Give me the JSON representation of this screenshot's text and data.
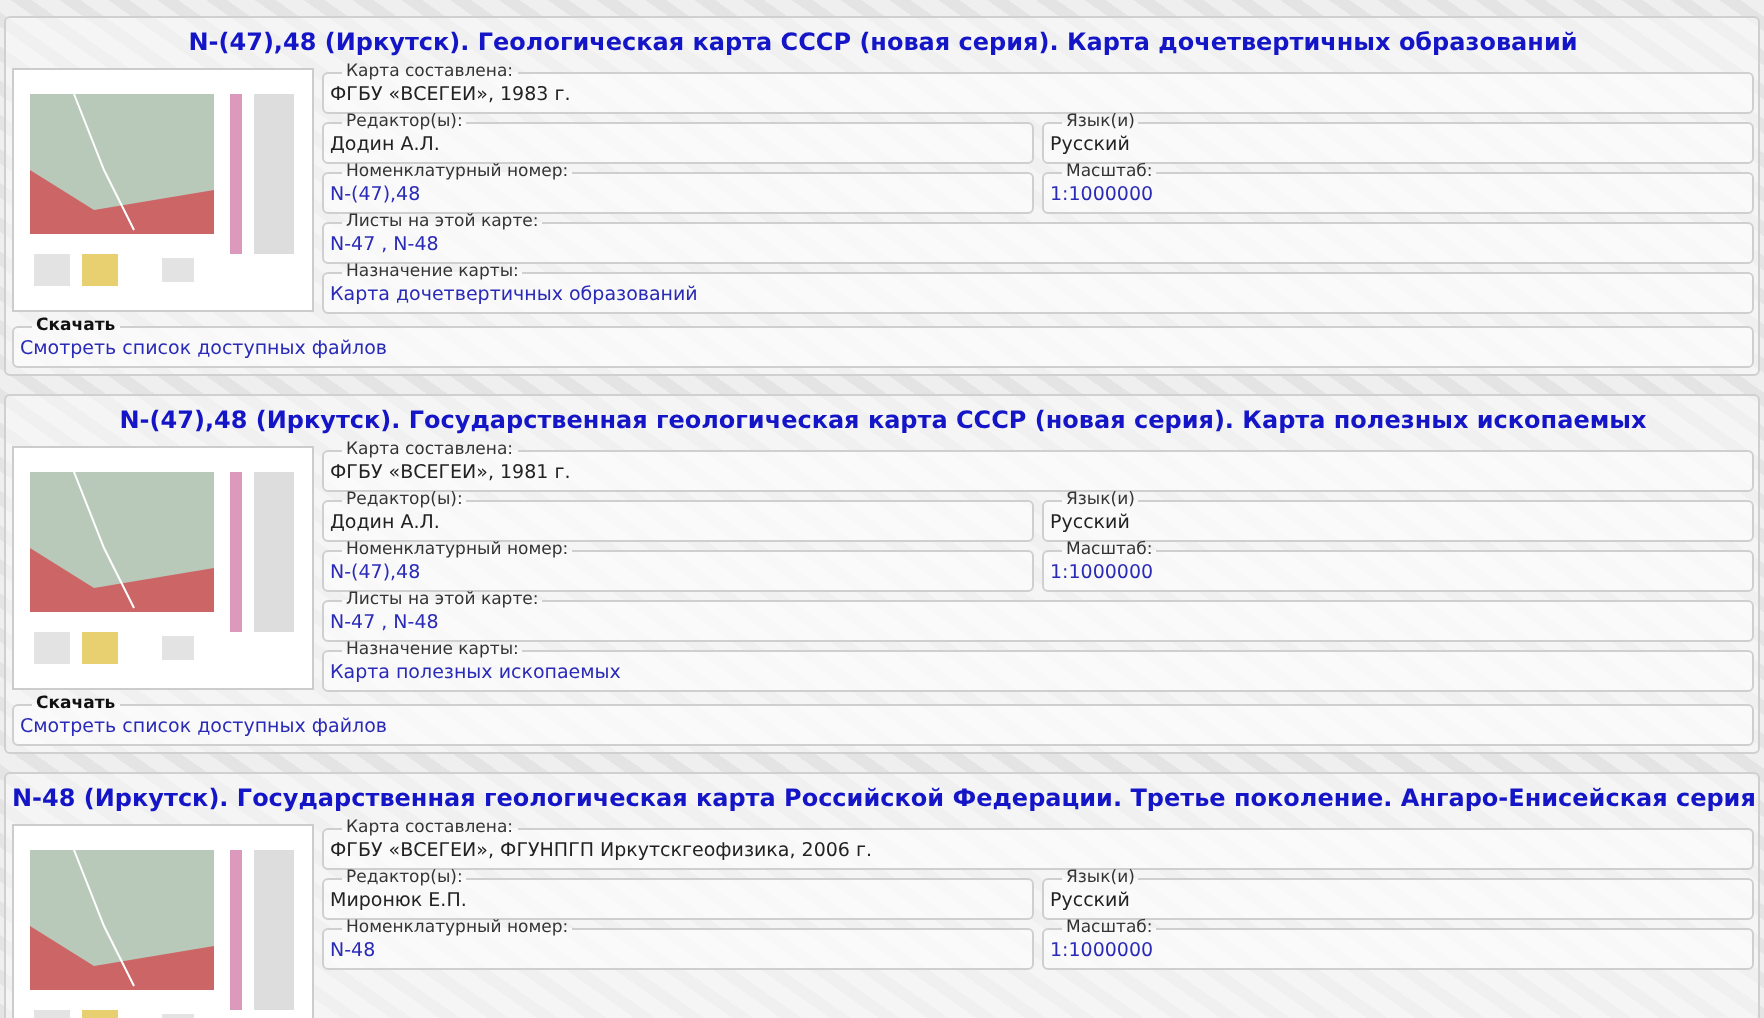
{
  "cards": [
    {
      "title": "N-(47),48 (Иркутск). Геологическая карта СССР (новая серия). Карта дочетвертичных образований",
      "rows": [
        [
          {
            "label": "Карта составлена:",
            "value": "ФГБУ «ВСЕГЕИ», 1983 г.",
            "kind": "text"
          }
        ],
        [
          {
            "label": "Редактор(ы):",
            "value": "Додин А.Л.",
            "kind": "text"
          },
          {
            "label": "Язык(и)",
            "value": "Русский",
            "kind": "text"
          }
        ],
        [
          {
            "label": "Номенклатурный номер:",
            "value": "N-(47),48",
            "kind": "link"
          },
          {
            "label": "Масштаб:",
            "value": "1:1000000",
            "kind": "link"
          }
        ],
        [
          {
            "label": "Листы на этой карте:",
            "value": "N-47 , N-48",
            "kind": "link"
          }
        ],
        [
          {
            "label": "Назначение карты:",
            "value": "Карта дочетвертичных образований",
            "kind": "link"
          }
        ]
      ],
      "download": {
        "label": "Скачать",
        "link": "Смотреть список доступных файлов"
      }
    },
    {
      "title": "N-(47),48 (Иркутск). Государственная геологическая карта СССР (новая серия). Карта полезных ископаемых",
      "rows": [
        [
          {
            "label": "Карта составлена:",
            "value": "ФГБУ «ВСЕГЕИ», 1981 г.",
            "kind": "text"
          }
        ],
        [
          {
            "label": "Редактор(ы):",
            "value": "Додин А.Л.",
            "kind": "text"
          },
          {
            "label": "Язык(и)",
            "value": "Русский",
            "kind": "text"
          }
        ],
        [
          {
            "label": "Номенклатурный номер:",
            "value": "N-(47),48",
            "kind": "link"
          },
          {
            "label": "Масштаб:",
            "value": "1:1000000",
            "kind": "link"
          }
        ],
        [
          {
            "label": "Листы на этой карте:",
            "value": "N-47 , N-48",
            "kind": "link"
          }
        ],
        [
          {
            "label": "Назначение карты:",
            "value": "Карта полезных ископаемых",
            "kind": "link"
          }
        ]
      ],
      "download": {
        "label": "Скачать",
        "link": "Смотреть список доступных файлов"
      }
    },
    {
      "title": "N-48 (Иркутск). Государственная геологическая карта Российской Федерации. Третье поколение. Ангаро-Енисейская серия",
      "rows": [
        [
          {
            "label": "Карта составлена:",
            "value": "ФГБУ «ВСЕГЕИ», ФГУНПГП Иркутскгеофизика, 2006 г.",
            "kind": "text"
          }
        ],
        [
          {
            "label": "Редактор(ы):",
            "value": "Миронюк Е.П.",
            "kind": "text"
          },
          {
            "label": "Язык(и)",
            "value": "Русский",
            "kind": "text"
          }
        ],
        [
          {
            "label": "Номенклатурный номер:",
            "value": "N-48",
            "kind": "link"
          },
          {
            "label": "Масштаб:",
            "value": "1:1000000",
            "kind": "link"
          }
        ]
      ]
    }
  ]
}
